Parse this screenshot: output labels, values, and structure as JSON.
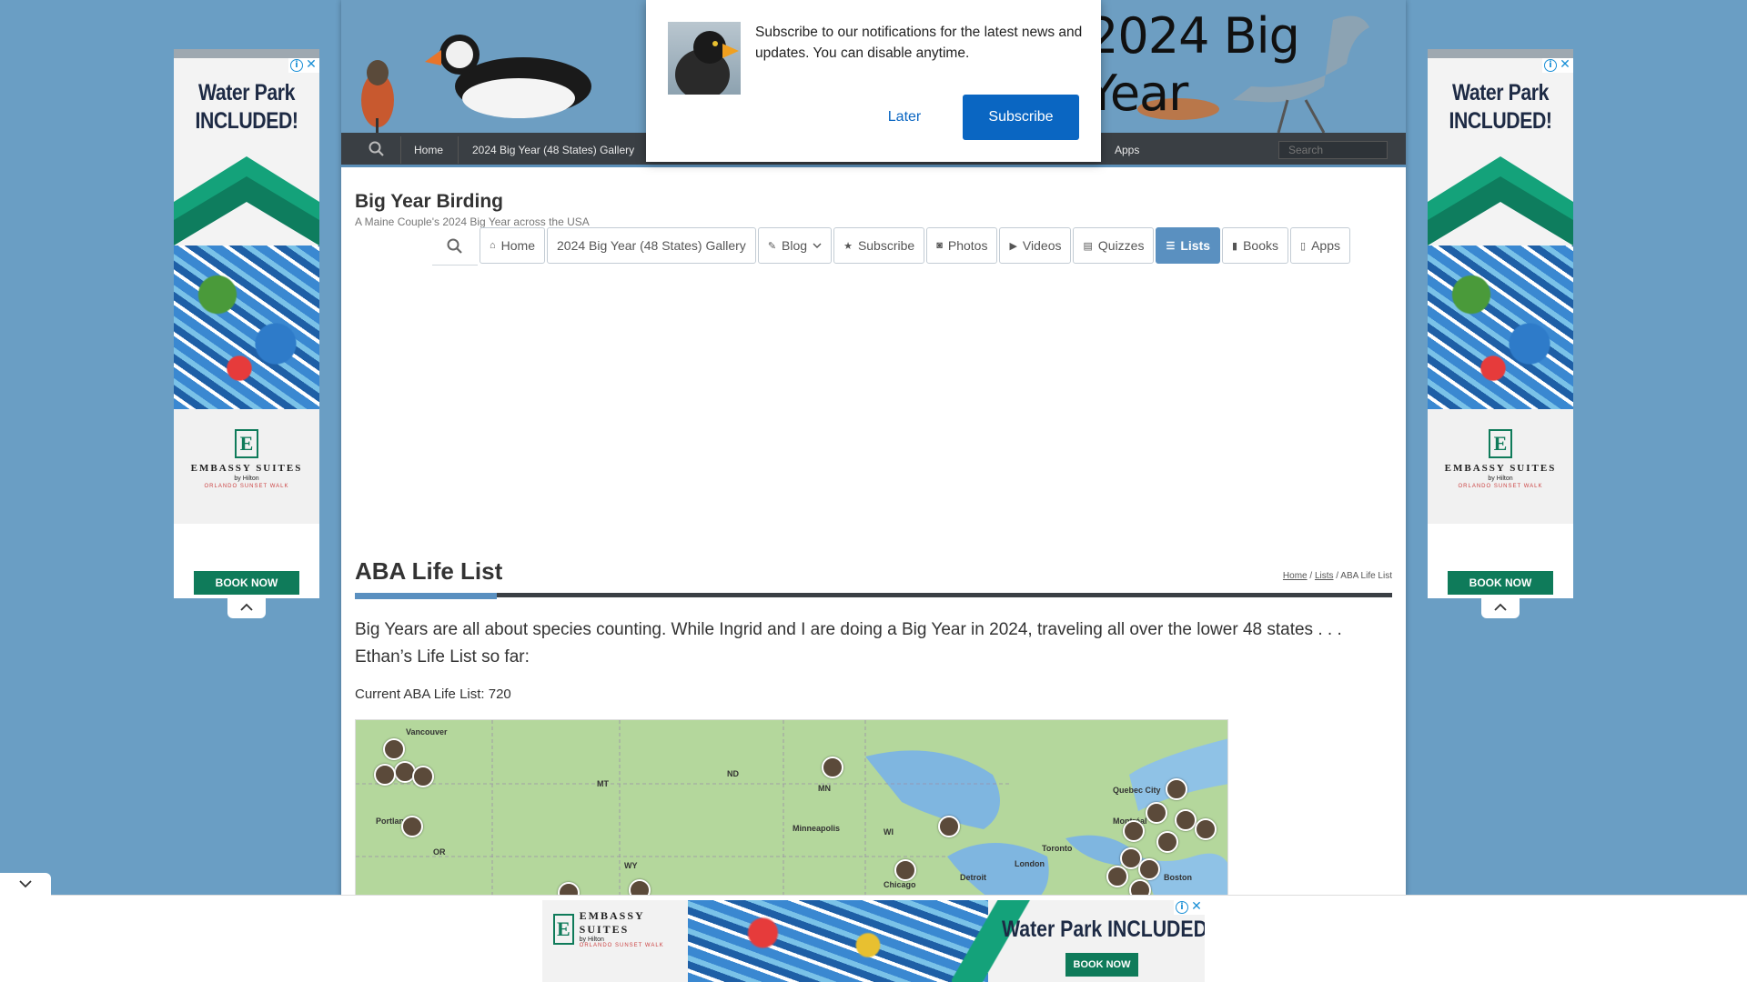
{
  "banner": {
    "title": "2024 Big Year"
  },
  "topnav": {
    "items": [
      "Home",
      "2024 Big Year (48 States) Gallery",
      "Apps"
    ],
    "search_placeholder": "Search"
  },
  "popup": {
    "message": "Subscribe to our notifications for the latest news and updates. You can disable anytime.",
    "later_label": "Later",
    "subscribe_label": "Subscribe"
  },
  "site": {
    "title": "Big Year Birding",
    "tagline": "A Maine Couple's 2024 Big Year across the USA"
  },
  "mainnav": {
    "items": [
      {
        "label": "Home",
        "icon": "home-icon"
      },
      {
        "label": "2024 Big Year (48 States) Gallery",
        "icon": ""
      },
      {
        "label": "Blog",
        "icon": "edit-icon"
      },
      {
        "label": "Subscribe",
        "icon": "star-icon"
      },
      {
        "label": "Photos",
        "icon": "camera-icon"
      },
      {
        "label": "Videos",
        "icon": "video-icon"
      },
      {
        "label": "Quizzes",
        "icon": "quiz-icon"
      },
      {
        "label": "Lists",
        "icon": "list-icon"
      },
      {
        "label": "Books",
        "icon": "book-icon"
      },
      {
        "label": "Apps",
        "icon": "phone-icon"
      }
    ],
    "active": "Lists"
  },
  "page": {
    "title": "ABA Life List",
    "breadcrumb": [
      "Home",
      "Lists",
      "ABA Life List"
    ],
    "intro": "Big Years are all about species counting.  While Ingrid and I are doing a Big Year in 2024, traveling all over the lower 48 states . . . Ethan’s Life List so far:",
    "count": "Current ABA Life List: 720"
  },
  "map": {
    "labels": [
      "Vancouver",
      "Portland",
      "Minneapolis",
      "Chicago",
      "Detroit",
      "Toronto",
      "London",
      "Montréal",
      "Quebec City",
      "Boston",
      "OR",
      "WY",
      "MN",
      "WI",
      "ND",
      "MT"
    ]
  },
  "ads": {
    "side_head_1": "Water Park",
    "side_head_2": "INCLUDED!",
    "brand": "EMBASSY SUITES",
    "sub_brand": "by Hilton",
    "location": "ORLANDO SUNSET WALK",
    "cta": "BOOK NOW",
    "bottom_head": "Water Park INCLUDED!"
  },
  "colors": {
    "accent": "#5a90c0",
    "nav_dark": "#3a3f44",
    "popup_button": "#0a66c2",
    "ad_green": "#0f7b5a"
  }
}
